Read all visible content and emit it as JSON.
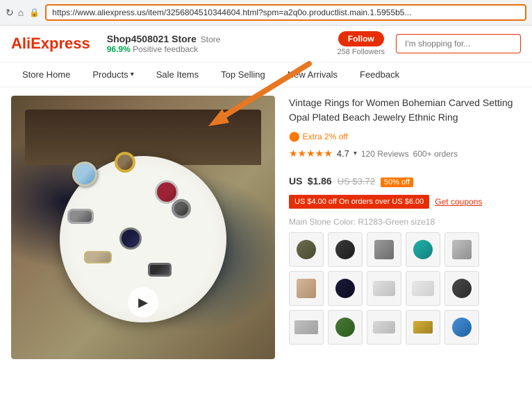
{
  "browser": {
    "url": "https://www.aliexpress.us/item/3256804510344604.html?spm=a2q0o.productlist.main.1.5955b5..."
  },
  "header": {
    "logo": "AliExpress",
    "store_name": "Shop4508021 Store",
    "store_badge": "Store",
    "feedback_percent": "96.9%",
    "feedback_label": "Positive feedback",
    "follow_label": "Follow",
    "followers_count": "258",
    "followers_label": "Followers",
    "search_placeholder": "I'm shopping for..."
  },
  "nav": {
    "items": [
      {
        "label": "Store Home",
        "has_arrow": false
      },
      {
        "label": "Products",
        "has_arrow": true
      },
      {
        "label": "Sale Items",
        "has_arrow": false
      },
      {
        "label": "Top Selling",
        "has_arrow": false
      },
      {
        "label": "New Arrivals",
        "has_arrow": false
      },
      {
        "label": "Feedback",
        "has_arrow": false
      }
    ]
  },
  "product": {
    "title": "Vintage Rings for Women Bohemian Carved Setting Opal Plated Beach Jewelry Ethnic Ring",
    "extra_off": "Extra 2% off",
    "rating": "4.7",
    "reviews": "120 Reviews",
    "orders": "600+ orders",
    "price_currency": "US",
    "price_main": "$1.86",
    "price_original": "US $3.72",
    "discount": "50% off",
    "coupon_text": "US $4.00 off On orders over US $6.00",
    "get_coupons": "Get coupons",
    "stone_color_label": "Main Stone Color:",
    "stone_color_value": "R1283-Green size18",
    "stone_colors": [
      {
        "color": "#6b6b50",
        "label": "olive"
      },
      {
        "color": "#2c2c2c",
        "label": "black"
      },
      {
        "color": "#8b8b8b",
        "label": "gray"
      },
      {
        "color": "#20b2aa",
        "label": "teal"
      },
      {
        "color": "#9b9b9b",
        "label": "silver-gray"
      },
      {
        "color": "#c8b89a",
        "label": "champagne"
      },
      {
        "color": "#1c1c2e",
        "label": "dark-blue"
      },
      {
        "color": "#d4d4d4",
        "label": "light-gray"
      },
      {
        "color": "#e0e0e0",
        "label": "white-gray"
      },
      {
        "color": "#3a3a3a",
        "label": "dark-gray"
      },
      {
        "color": "#b0b0b0",
        "label": "silver"
      },
      {
        "color": "#556b2f",
        "label": "dark-green"
      },
      {
        "color": "#c0c0c0",
        "label": "silver2"
      },
      {
        "color": "#d4af37",
        "label": "gold"
      },
      {
        "color": "#4a90d9",
        "label": "blue"
      }
    ]
  },
  "icons": {
    "reload": "↻",
    "home": "⌂",
    "lock": "🔒",
    "play": "▶",
    "star": "★",
    "chevron": "›"
  }
}
